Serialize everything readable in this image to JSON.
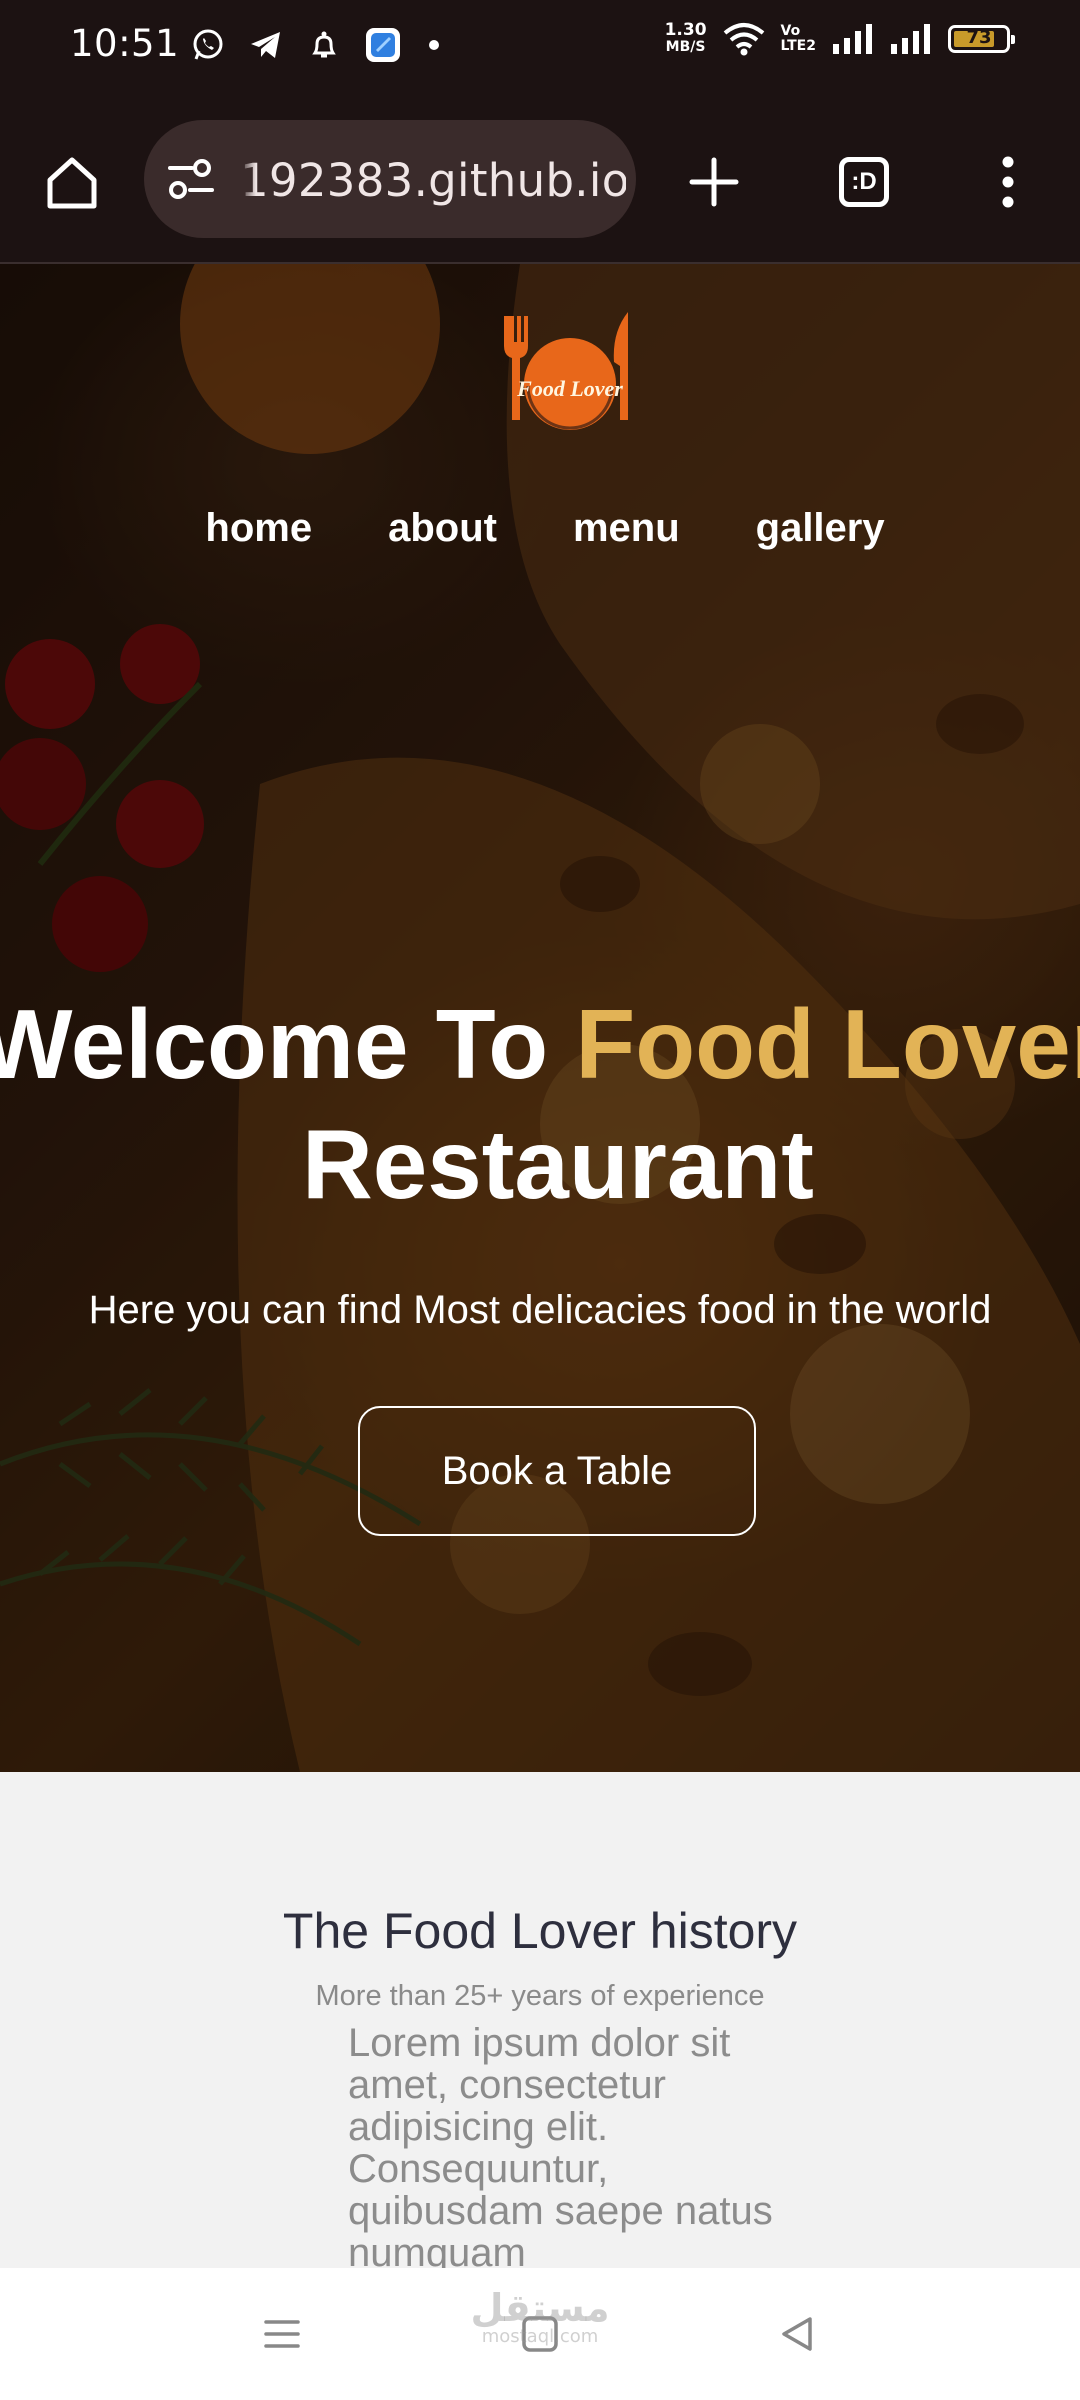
{
  "status_bar": {
    "time": "10:51",
    "left_icons": [
      "whatsapp-icon",
      "telegram-icon",
      "notification-bell-icon",
      "app-icon",
      "dot-icon"
    ],
    "net_speed_value": "1.30",
    "net_speed_unit": "MB/S",
    "volte_label_top": "Vo",
    "volte_label_bottom": "LTE2",
    "battery_level": "73"
  },
  "browser": {
    "url": "192383.github.io",
    "tab_count_label": ":D",
    "icons": [
      "home-icon",
      "site-settings-icon",
      "new-tab-icon",
      "tab-switcher-icon",
      "more-vert-icon"
    ]
  },
  "hero": {
    "logo_text": "Food Lover",
    "nav": [
      "home",
      "about",
      "menu",
      "gallery"
    ],
    "title_part1": "Welcome To ",
    "title_accent": "Food Lover",
    "title_line2": "Restaurant",
    "subtitle": "Here you can find Most delicacies food in the world",
    "cta_label": "Book a Table",
    "colors": {
      "accent": "#e2b356",
      "logo_orange": "#e8671a"
    }
  },
  "history": {
    "title": "The Food Lover history",
    "subtitle": "More than 25+ years of experience",
    "body": "Lorem ipsum dolor sit amet, consectetur adipisicing elit. Consequuntur, quibusdam saepe natus numquam"
  },
  "system_nav": {
    "watermark_ar": "مستقل",
    "watermark_en": "mostaql.com",
    "icons": [
      "recent-apps-icon",
      "home-square-icon",
      "back-triangle-icon"
    ]
  }
}
